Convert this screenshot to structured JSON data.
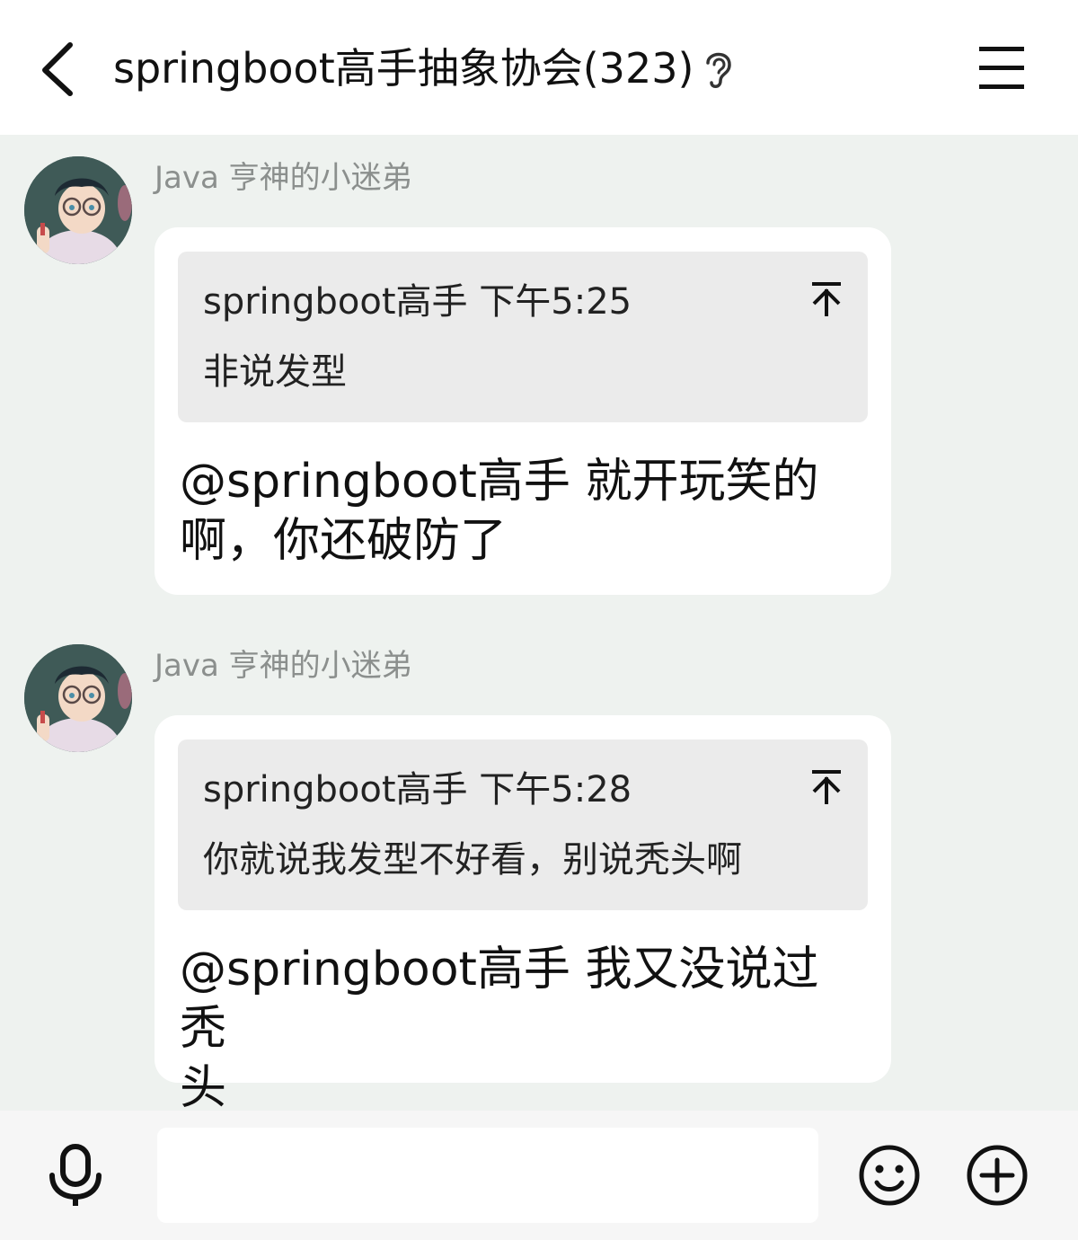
{
  "header": {
    "title": "springboot高手抽象协会(323)",
    "icons": [
      "back-icon",
      "ear-icon",
      "menu-icon"
    ]
  },
  "messages": [
    {
      "sender": "Java 亨神的小迷弟",
      "quote": {
        "author_time": "springboot高手 下午5:25",
        "text": "非说发型"
      },
      "text_line1": "@springboot高手 就开玩笑的",
      "text_line2": "啊，你还破防了"
    },
    {
      "sender": "Java 亨神的小迷弟",
      "quote": {
        "author_time": "springboot高手 下午5:28",
        "text": "你就说我发型不好看，别说秃头啊"
      },
      "text_line1": "@springboot高手 我又没说过秃",
      "text_line2": "头"
    }
  ],
  "footer": {
    "input_value": "",
    "icons": [
      "mic-icon",
      "emoji-icon",
      "plus-icon"
    ]
  },
  "colors": {
    "chat_background": "#eef2ef",
    "bubble": "#ffffff",
    "quote_background": "#ebebeb",
    "sender_text": "#8b8f8d"
  }
}
